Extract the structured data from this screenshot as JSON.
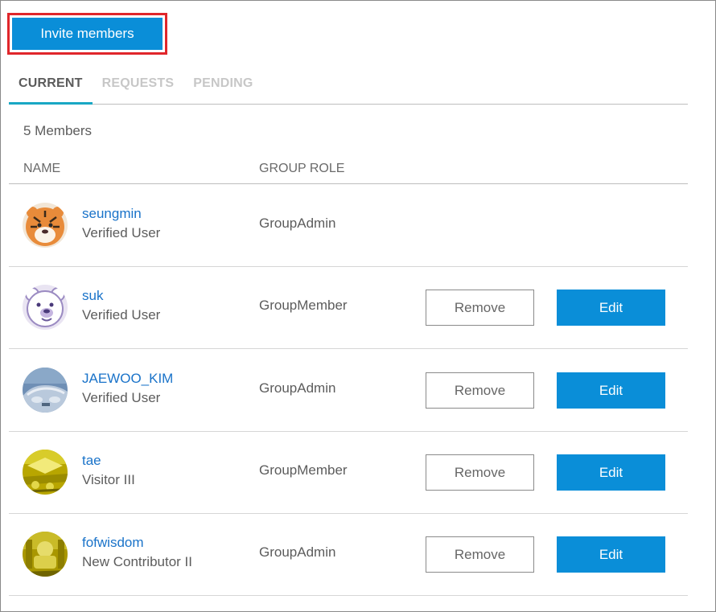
{
  "toolbar": {
    "invite_label": "Invite members"
  },
  "tabs": [
    {
      "label": "CURRENT",
      "active": true
    },
    {
      "label": "REQUESTS",
      "active": false
    },
    {
      "label": "PENDING",
      "active": false
    }
  ],
  "summary": {
    "member_count": "5 Members"
  },
  "table": {
    "headers": {
      "name": "NAME",
      "role": "GROUP ROLE"
    },
    "remove_label": "Remove",
    "edit_label": "Edit",
    "rows": [
      {
        "name": "seungmin",
        "level": "Verified User",
        "role": "GroupAdmin",
        "avatar": "tiger-avatar",
        "has_actions": false
      },
      {
        "name": "suk",
        "level": "Verified User",
        "role": "GroupMember",
        "avatar": "polar-bear-avatar",
        "has_actions": true
      },
      {
        "name": "JAEWOO_KIM",
        "level": "Verified User",
        "role": "GroupAdmin",
        "avatar": "car-avatar",
        "has_actions": true
      },
      {
        "name": "tae",
        "level": "Visitor III",
        "role": "GroupMember",
        "avatar": "yellow-pattern-avatar",
        "has_actions": true
      },
      {
        "name": "fofwisdom",
        "level": "New Contributor II",
        "role": "GroupAdmin",
        "avatar": "yellow-figure-avatar",
        "has_actions": true
      }
    ]
  },
  "colors": {
    "primary": "#0a8ed8",
    "highlight_border": "#e0262b",
    "tab_underline": "#19a7c4",
    "link": "#1a73c9"
  }
}
